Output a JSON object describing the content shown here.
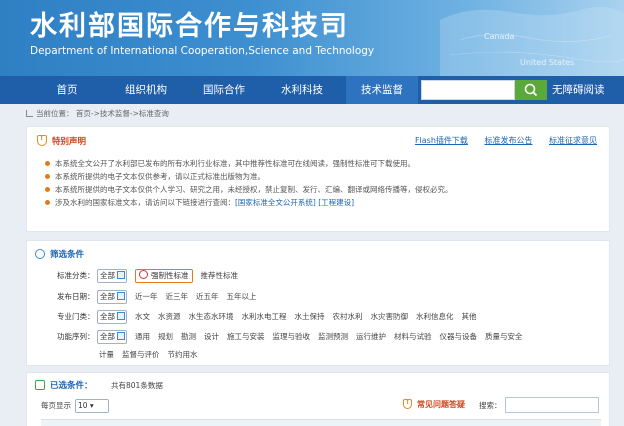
{
  "header": {
    "title": "水利部国际合作与科技司",
    "subtitle": "Department of International Cooperation,Science and Technology",
    "map_labels": [
      "Canada",
      "United States"
    ]
  },
  "nav": {
    "items": [
      "首页",
      "组织机构",
      "国际合作",
      "水利科技",
      "技术监督"
    ],
    "active": "水利科技",
    "search_placeholder": "",
    "accessible_label": "无障碍阅读"
  },
  "breadcrumb": {
    "prefix": "当前位置：",
    "path": "首页->技术监督->标准查询"
  },
  "notice": {
    "title": "特别声明",
    "links": [
      "Flash插件下载",
      "标准发布公告",
      "标准征求意见"
    ],
    "lines": [
      "本系统全文公开了水利部已发布的所有水利行业标准，其中推荐性标准可在线阅读，强制性标准可下载使用。",
      "本系统所提供的电子文本仅供参考，请以正式标准出版物为准。",
      "本系统所提供的电子文本仅供个人学习、研究之用，未经授权，禁止复制、发行、汇编、翻译或网络传播等，侵权必究。"
    ],
    "last_line_text": "涉及水利的国家标准文本，请访问以下链接进行查阅：",
    "last_line_links": [
      "[国家标准全文公开系统]",
      "[工程建设]"
    ]
  },
  "filter": {
    "title": "筛选条件",
    "rows": [
      {
        "label": "标准分类：",
        "select": "全部",
        "options": [
          "强制性标准",
          "推荐性标准"
        ]
      },
      {
        "label": "发布日期：",
        "select": "全部",
        "options": [
          "近一年",
          "近三年",
          "近五年",
          "五年以上"
        ]
      },
      {
        "label": "专业门类：",
        "select": "全部",
        "options": [
          "水文",
          "水资源",
          "水生态水环境",
          "水利水电工程",
          "水土保持",
          "农村水利",
          "水灾害防御",
          "水利信息化",
          "其他"
        ]
      },
      {
        "label": "功能序列：",
        "select": "全部",
        "options": [
          "通用",
          "规划",
          "勘测",
          "设计",
          "施工与安装",
          "监理与验收",
          "监测预测",
          "运行维护",
          "材料与试验",
          "仪器与设备",
          "质量与安全"
        ]
      }
    ],
    "row4_wrap": [
      "计量",
      "监督与评价",
      "节约用水"
    ]
  },
  "results": {
    "title": "已选条件：",
    "count_text": "共有801条数据",
    "per_page_label": "每页显示",
    "per_page_value": "10",
    "faq_label": "常见问题答疑",
    "search_label": "搜索："
  },
  "colors": {
    "nav_bg": "#1f5ea8",
    "accent_orange": "#e07a1e",
    "link_blue": "#1f64b5",
    "search_green": "#5aa93a"
  }
}
